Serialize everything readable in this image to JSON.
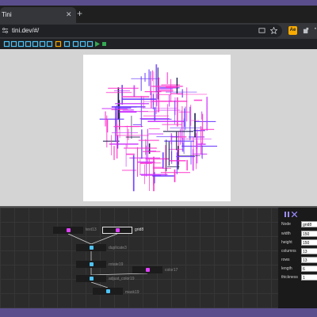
{
  "browser": {
    "tab_title": "Tini",
    "tab_close": "✕",
    "new_tab": "+",
    "url": "tini.dev/#/"
  },
  "bookmarks": [
    {
      "name": "grid-icon",
      "color": "#4fc3f7"
    },
    {
      "name": "link-icon",
      "color": "#4fc3f7"
    },
    {
      "name": "list-icon",
      "color": "#4fc3f7"
    },
    {
      "name": "stack-icon",
      "color": "#4fc3f7"
    },
    {
      "name": "download-icon",
      "color": "#4fc3f7"
    },
    {
      "name": "flask-icon",
      "color": "#4fc3f7"
    },
    {
      "name": "infinity-icon",
      "color": "#4fc3f7"
    },
    {
      "name": "palette-icon",
      "color": "#f9ab00"
    },
    {
      "name": "eye-icon",
      "color": "#4fc3f7"
    },
    {
      "name": "rewind-icon",
      "color": "#4fc3f7"
    },
    {
      "name": "step-back-icon",
      "color": "#4fc3f7"
    },
    {
      "name": "step-forward-icon",
      "color": "#4fc3f7"
    },
    {
      "name": "play-icon",
      "color": "#34a853"
    },
    {
      "name": "stop-icon",
      "color": "#34a853"
    }
  ],
  "nodes": [
    {
      "id": "text13",
      "label": "text13",
      "glyph": "#e040fb",
      "selected": false
    },
    {
      "id": "grid8",
      "label": "grid8",
      "glyph": "#e040fb",
      "selected": true
    },
    {
      "id": "duplicate3",
      "label": "duplicate3",
      "glyph": "#4fc3f7",
      "selected": false
    },
    {
      "id": "rotate19",
      "label": "rotate19",
      "glyph": "#4fc3f7",
      "selected": false
    },
    {
      "id": "color17",
      "label": "color17",
      "glyph": "#e040fb",
      "selected": false
    },
    {
      "id": "adjust_color",
      "label": "adjust_color19",
      "glyph": "#4fc3f7",
      "selected": false
    },
    {
      "id": "mask19",
      "label": "mask19",
      "glyph": "#4fc3f7",
      "selected": false
    }
  ],
  "inspector": {
    "props": [
      {
        "label": "Node",
        "value": "grid8"
      },
      {
        "label": "width",
        "value": "150"
      },
      {
        "label": "height",
        "value": "150"
      },
      {
        "label": "columns",
        "value": "13"
      },
      {
        "label": "rows",
        "value": "13"
      },
      {
        "label": "length",
        "value": "6"
      },
      {
        "label": "thickness",
        "value": "1"
      }
    ]
  },
  "colors": {
    "stroke_a": "#ff33cc",
    "stroke_b": "#cc33ff",
    "stroke_c": "#6633ff",
    "stroke_d": "#1a1a4d"
  }
}
